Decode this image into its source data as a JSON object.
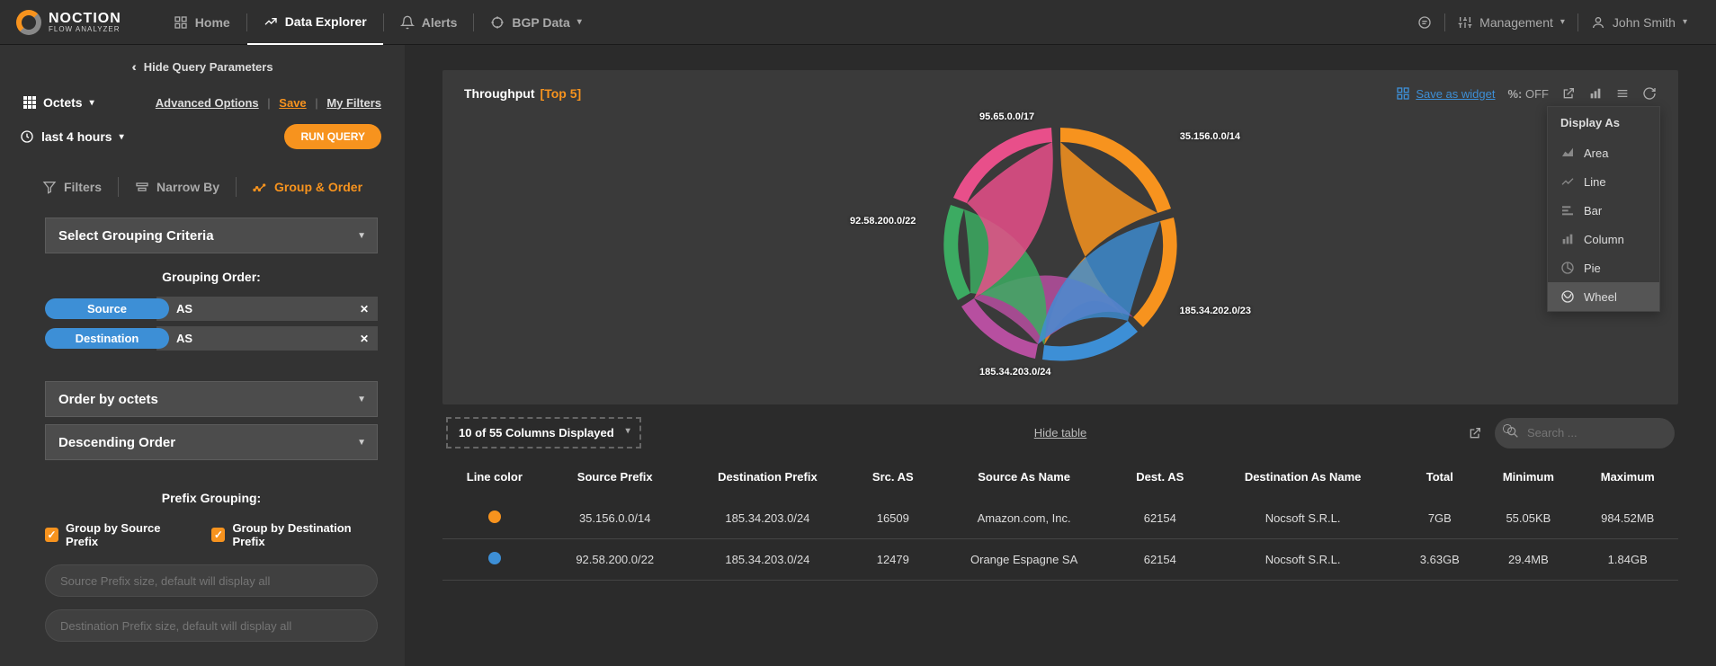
{
  "brand": {
    "name": "NOCTION",
    "sub": "FLOW ANALYZER"
  },
  "nav": {
    "home": "Home",
    "explorer": "Data Explorer",
    "alerts": "Alerts",
    "bgp": "BGP Data",
    "management": "Management",
    "user": "John Smith"
  },
  "sidebar": {
    "hide_query": "Hide Query Parameters",
    "metric": "Octets",
    "advanced": "Advanced Options",
    "save": "Save",
    "my_filters": "My Filters",
    "time": "last 4 hours",
    "run": "RUN QUERY",
    "tabs": {
      "filters": "Filters",
      "narrow": "Narrow By",
      "group": "Group & Order"
    },
    "grouping_criteria": "Select Grouping Criteria",
    "grouping_order_label": "Grouping Order:",
    "chips": [
      {
        "blue": "Source",
        "gray": "AS"
      },
      {
        "blue": "Destination",
        "gray": "AS"
      }
    ],
    "order_by": "Order by octets",
    "sort": "Descending Order",
    "prefix_grouping": "Prefix Grouping:",
    "chk1": "Group by Source Prefix",
    "chk2": "Group by Destination Prefix",
    "src_prefix_ph": "Source Prefix size, default will display all",
    "dst_prefix_ph": "Destination Prefix size, default will display all"
  },
  "chart": {
    "title": "Throughput",
    "top": "[Top 5]",
    "save_widget": "Save as widget",
    "pct": "%:",
    "off": "OFF",
    "display_as": "Display As",
    "options": [
      "Area",
      "Line",
      "Bar",
      "Column",
      "Pie",
      "Wheel"
    ],
    "selected": "Wheel",
    "labels": {
      "a": "95.65.0.0/17",
      "b": "35.156.0.0/14",
      "c": "92.58.200.0/22",
      "d": "185.34.202.0/23",
      "e": "185.34.203.0/24"
    }
  },
  "chart_data": {
    "type": "pie",
    "title": "Throughput [Top 5]",
    "categories": [
      "35.156.0.0/14",
      "185.34.202.0/23",
      "185.34.203.0/24",
      "92.58.200.0/22",
      "95.65.0.0/17"
    ],
    "values": [
      35,
      18,
      22,
      15,
      10
    ],
    "colors": [
      "#f7931e",
      "#3d8fd6",
      "#b74fa0",
      "#3cab62",
      "#e84f8a"
    ],
    "note": "Chord/wheel diagram showing flows between 5 prefixes; arc sizes approximate share of total octets. Inner ribbons connect source↔destination pairs."
  },
  "columns_btn": "10 of 55 Columns Displayed",
  "hide_table": "Hide table",
  "search_ph": "Search ...",
  "table": {
    "headers": [
      "Line color",
      "Source Prefix",
      "Destination Prefix",
      "Src. AS",
      "Source As Name",
      "Dest. AS",
      "Destination As Name",
      "Total",
      "Minimum",
      "Maximum"
    ],
    "rows": [
      {
        "color": "#f7931e",
        "src": "35.156.0.0/14",
        "dst": "185.34.203.0/24",
        "srcas": "16509",
        "srcname": "Amazon.com, Inc.",
        "dstas": "62154",
        "dstname": "Nocsoft S.R.L.",
        "total": "7GB",
        "min": "55.05KB",
        "max": "984.52MB"
      },
      {
        "color": "#3d8fd6",
        "src": "92.58.200.0/22",
        "dst": "185.34.203.0/24",
        "srcas": "12479",
        "srcname": "Orange Espagne SA",
        "dstas": "62154",
        "dstname": "Nocsoft S.R.L.",
        "total": "3.63GB",
        "min": "29.4MB",
        "max": "1.84GB"
      }
    ]
  }
}
